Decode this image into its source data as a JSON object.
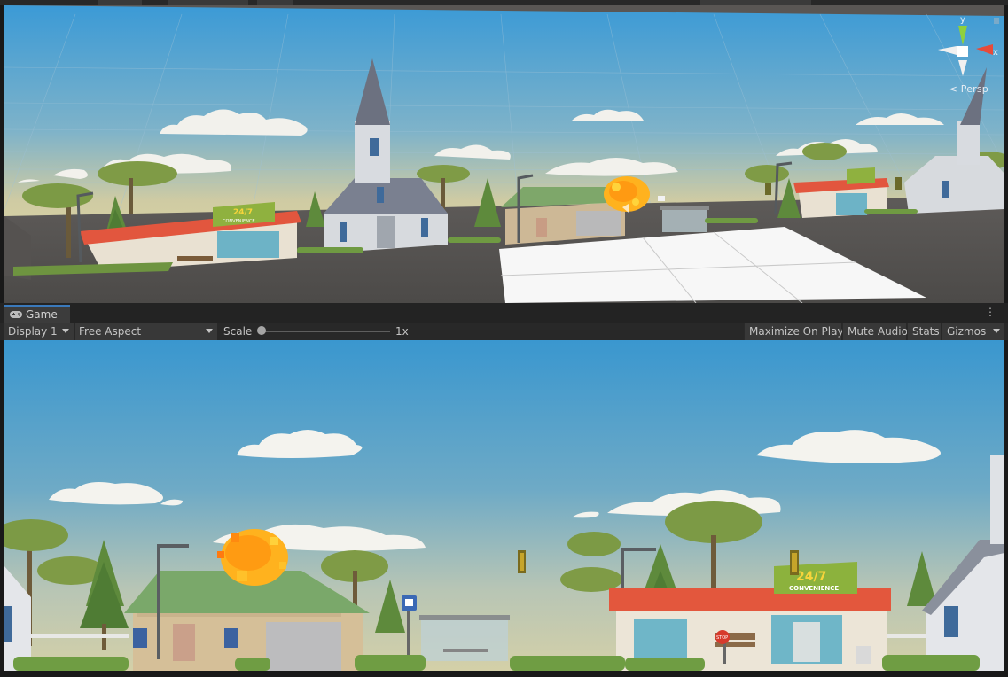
{
  "scene_view": {
    "gizmo": {
      "axis_y": "y",
      "axis_x": "x",
      "projection_label": "Persp",
      "icon": "axis-gizmo-icon"
    },
    "signs": {
      "convenience_top": "24/7",
      "convenience_bottom": "CONVENIENCE"
    }
  },
  "game_view": {
    "tab_label": "Game",
    "tab_icon": "gamepad-icon",
    "toolbar": {
      "display": "Display 1",
      "aspect": "Free Aspect",
      "scale_label": "Scale",
      "scale_value": "1x",
      "scale_level": 0,
      "maximize_on_play": "Maximize On Play",
      "mute_audio": "Mute Audio",
      "stats": "Stats",
      "gizmos": "Gizmos"
    },
    "signs": {
      "convenience_top": "24/7",
      "convenience_bottom": "CONVENIENCE",
      "stop": "STOP"
    }
  },
  "colors": {
    "editor_bg": "#191919",
    "tab_accent": "#3a79bb",
    "sky_top": "#3b9ad6",
    "sky_bottom": "#d8d2a4",
    "fire": "#ffb21e"
  }
}
